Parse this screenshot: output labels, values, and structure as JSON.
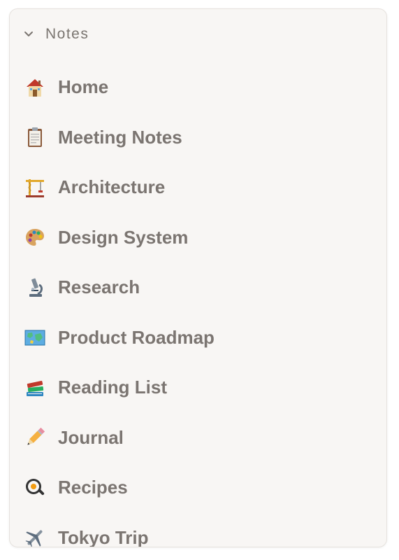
{
  "sidebar": {
    "section": {
      "title": "Notes",
      "icon": "chevron-down-icon",
      "expanded": true
    },
    "items": [
      {
        "label": "Home",
        "icon": "house-icon"
      },
      {
        "label": "Meeting Notes",
        "icon": "clipboard-icon"
      },
      {
        "label": "Architecture",
        "icon": "crane-icon"
      },
      {
        "label": "Design System",
        "icon": "palette-icon"
      },
      {
        "label": "Research",
        "icon": "microscope-icon"
      },
      {
        "label": "Product Roadmap",
        "icon": "map-icon"
      },
      {
        "label": "Reading List",
        "icon": "books-icon"
      },
      {
        "label": "Journal",
        "icon": "pencil-icon"
      },
      {
        "label": "Recipes",
        "icon": "frying-pan-icon"
      },
      {
        "label": "Tokyo Trip",
        "icon": "airplane-icon"
      }
    ]
  },
  "colors": {
    "panel_background": "#f8f6f4",
    "text": "#7b7571",
    "header_text": "#7a7570"
  }
}
